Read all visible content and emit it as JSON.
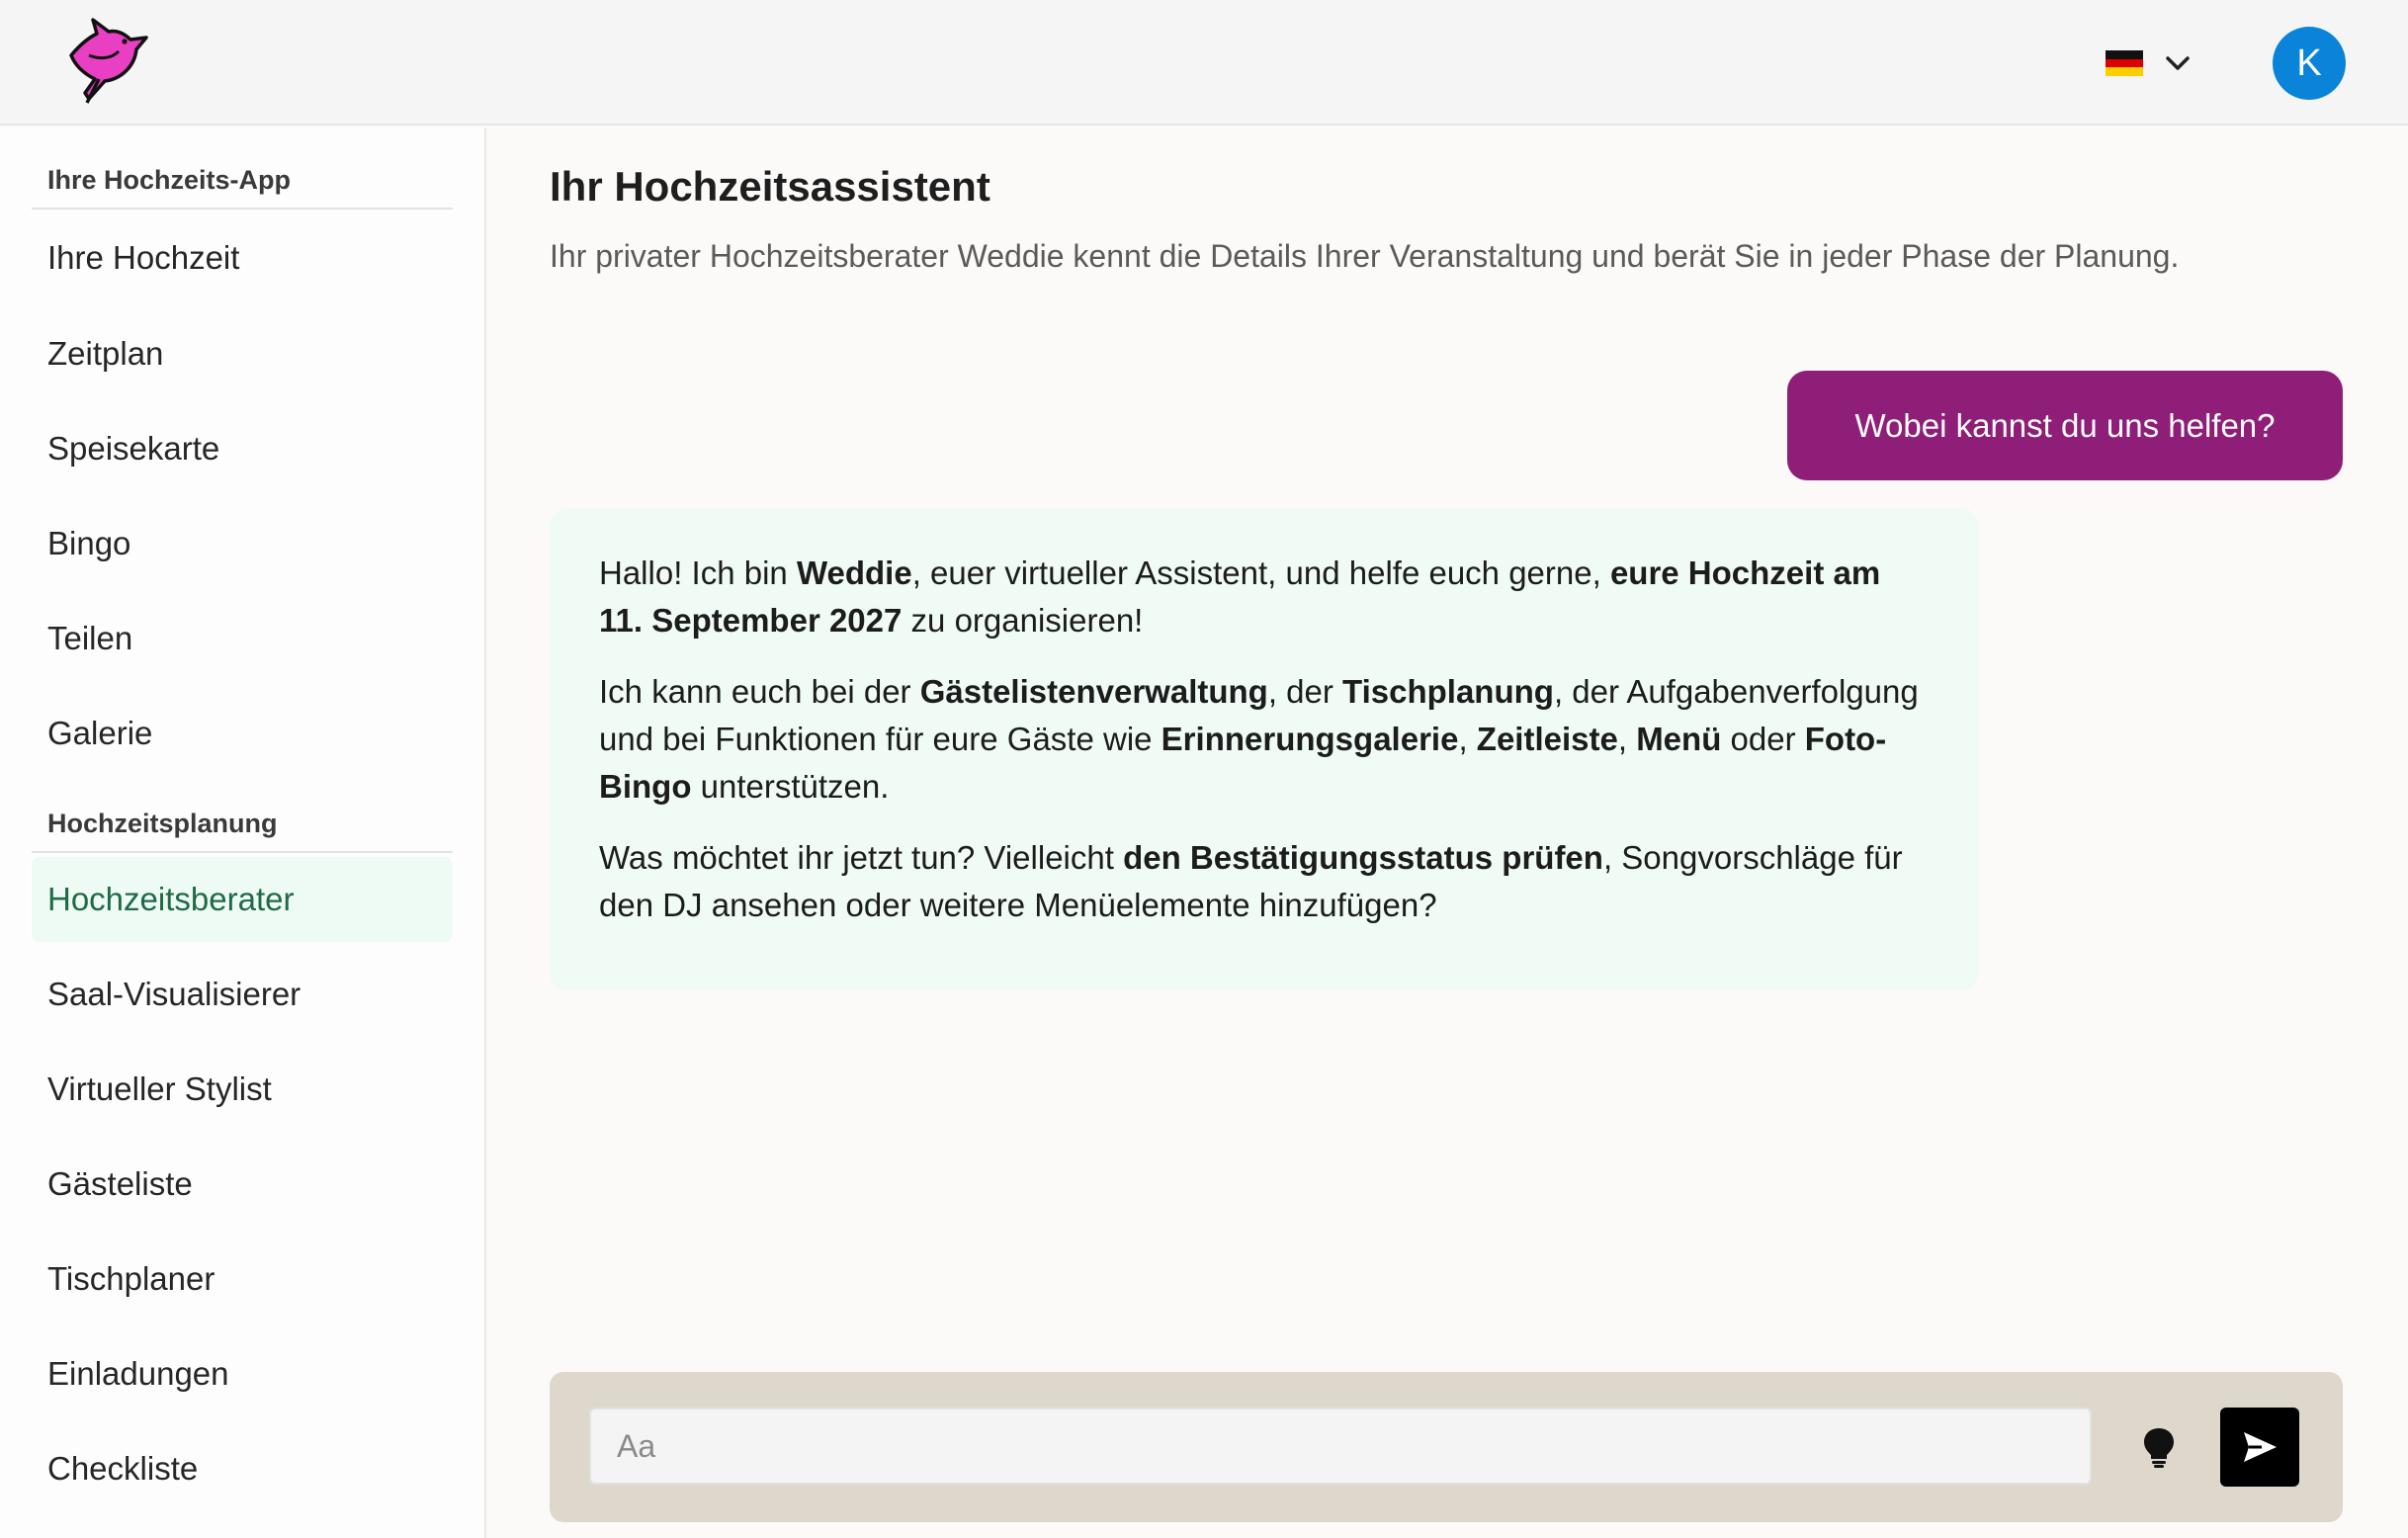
{
  "header": {
    "logo_icon": "dove-icon",
    "language_flag": "german-flag-icon",
    "language_chevron": "chevron-down-icon",
    "avatar_initial": "K",
    "colors": {
      "avatar": "#0a84d8",
      "logo": "#e83fc3"
    }
  },
  "sidebar": {
    "sections": [
      {
        "title": "Ihre Hochzeits-App",
        "items": [
          {
            "label": "Ihre Hochzeit"
          },
          {
            "label": "Zeitplan"
          },
          {
            "label": "Speisekarte"
          },
          {
            "label": "Bingo"
          },
          {
            "label": "Teilen"
          },
          {
            "label": "Galerie"
          }
        ]
      },
      {
        "title": "Hochzeitsplanung",
        "items": [
          {
            "label": "Hochzeitsberater",
            "active": true
          },
          {
            "label": "Saal-Visualisierer"
          },
          {
            "label": "Virtueller Stylist"
          },
          {
            "label": "Gästeliste"
          },
          {
            "label": "Tischplaner"
          },
          {
            "label": "Einladungen"
          },
          {
            "label": "Checkliste"
          }
        ]
      }
    ]
  },
  "main": {
    "title": "Ihr Hochzeitsassistent",
    "subtitle": "Ihr privater Hochzeitsberater Weddie kennt die Details Ihrer Veranstaltung und berät Sie in jeder Phase der Planung.",
    "user_message": "Wobei kannst du uns helfen?",
    "bot_message": {
      "p1": {
        "t1": "Hallo! Ich bin ",
        "b1": "Weddie",
        "t2": ", euer virtueller Assistent, und helfe euch gerne, ",
        "b2": "eure Hochzeit am 11. September 2027",
        "t3": " zu organisieren!"
      },
      "p2": {
        "t1": "Ich kann euch bei der ",
        "b1": "Gästelistenverwaltung",
        "t2": ", der ",
        "b2": "Tischplanung",
        "t3": ", der Aufgabenverfolgung und bei Funktionen für eure Gäste wie ",
        "b3": "Erinnerungsgalerie",
        "t4": ", ",
        "b4": "Zeitleiste",
        "t5": ", ",
        "b5": "Menü",
        "t6": " oder ",
        "b6": "Foto-Bingo",
        "t7": " unterstützen."
      },
      "p3": {
        "t1": "Was möchtet ihr jetzt tun? Vielleicht ",
        "b1": "den Bestätigungsstatus prüfen",
        "t2": ", Songvorschläge für den DJ ansehen oder weitere Menüelemente hinzufügen?"
      }
    },
    "composer": {
      "placeholder": "Aa",
      "value": "",
      "hint_icon": "lightbulb-icon",
      "send_icon": "send-icon"
    },
    "colors": {
      "user_bubble": "#8f1e78",
      "bot_bubble": "#effbf4",
      "active_nav": "#1f6b45"
    }
  }
}
